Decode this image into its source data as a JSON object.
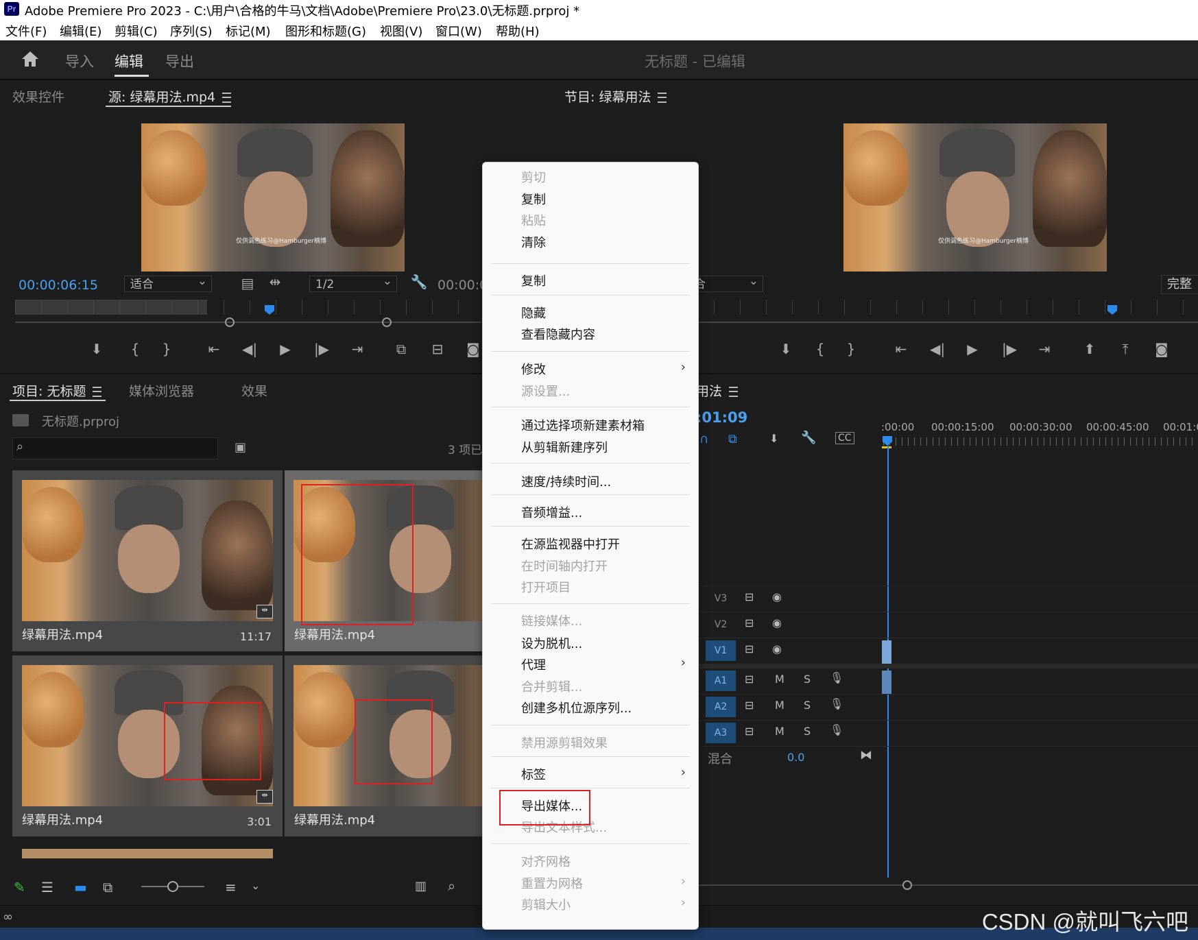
{
  "titlebar": {
    "app_icon": "Pr",
    "title": "Adobe Premiere Pro 2023 - C:\\用户\\合格的牛马\\文档\\Adobe\\Premiere Pro\\23.0\\无标题.prproj *"
  },
  "menubar": [
    "文件(F)",
    "编辑(E)",
    "剪辑(C)",
    "序列(S)",
    "标记(M)",
    "图形和标题(G)",
    "视图(V)",
    "窗口(W)",
    "帮助(H)"
  ],
  "workspace": {
    "tabs": [
      "导入",
      "编辑",
      "导出"
    ],
    "active_tab": "编辑",
    "project_status": "无标题 - 已编辑"
  },
  "source_panel": {
    "tabs": [
      "效果控件",
      "源: 绿幕用法.mp4"
    ],
    "timecode": "00:00:06:15",
    "fit": "适合",
    "resolution": "1/2",
    "timecode_right": "00:00:0",
    "video_caption": "仅供调色练习@Hamburger楠博"
  },
  "program_panel": {
    "tab": "节目: 绿幕用法",
    "fit": "合",
    "quality": "完整"
  },
  "project_panel": {
    "tabs": [
      "项目: 无标题",
      "媒体浏览器",
      "效果"
    ],
    "project_file": "无标题.prproj",
    "item_count": "3 项已",
    "items": [
      {
        "name": "绿幕用法.mp4",
        "duration": "11:17"
      },
      {
        "name": "绿幕用法.mp4",
        "duration": ""
      },
      {
        "name": "绿幕用法.mp4",
        "duration": "3:01"
      },
      {
        "name": "绿幕用法.mp4",
        "duration": ""
      }
    ]
  },
  "timeline": {
    "tab": "用法",
    "timecode": ":01:09",
    "ruler": [
      ":00:00",
      "00:00:15:00",
      "00:00:30:00",
      "00:00:45:00",
      "00:01:0"
    ],
    "video_tracks": [
      "V3",
      "V2",
      "V1"
    ],
    "audio_tracks": [
      "A1",
      "A2",
      "A3"
    ],
    "mute": "M",
    "solo": "S",
    "mix_label": "混合",
    "mix_value": "0.0"
  },
  "context_menu": [
    {
      "label": "剪切",
      "enabled": false
    },
    {
      "label": "复制",
      "enabled": true
    },
    {
      "label": "粘贴",
      "enabled": false
    },
    {
      "label": "清除",
      "enabled": true
    },
    {
      "label": "复制",
      "enabled": true
    },
    {
      "label": "隐藏",
      "enabled": true
    },
    {
      "label": "查看隐藏内容",
      "enabled": true
    },
    {
      "label": "修改",
      "enabled": true,
      "submenu": true
    },
    {
      "label": "源设置...",
      "enabled": false
    },
    {
      "label": "通过选择项新建素材箱",
      "enabled": true
    },
    {
      "label": "从剪辑新建序列",
      "enabled": true
    },
    {
      "label": "速度/持续时间...",
      "enabled": true
    },
    {
      "label": "音频增益...",
      "enabled": true
    },
    {
      "label": "在源监视器中打开",
      "enabled": true
    },
    {
      "label": "在时间轴内打开",
      "enabled": false
    },
    {
      "label": "打开项目",
      "enabled": false
    },
    {
      "label": "链接媒体...",
      "enabled": false
    },
    {
      "label": "设为脱机...",
      "enabled": true
    },
    {
      "label": "代理",
      "enabled": true,
      "submenu": true
    },
    {
      "label": "合并剪辑...",
      "enabled": false
    },
    {
      "label": "创建多机位源序列...",
      "enabled": true
    },
    {
      "label": "禁用源剪辑效果",
      "enabled": false
    },
    {
      "label": "标签",
      "enabled": true,
      "submenu": true
    },
    {
      "label": "导出媒体...",
      "enabled": true
    },
    {
      "label": "导出文本样式...",
      "enabled": false
    },
    {
      "label": "对齐网格",
      "enabled": false
    },
    {
      "label": "重置为网格",
      "enabled": false,
      "submenu": true
    },
    {
      "label": "剪辑大小",
      "enabled": false,
      "submenu": true
    }
  ],
  "watermark": "CSDN @就叫飞六吧",
  "colors": {
    "accent_blue": "#2d8ceb",
    "highlight_red": "#e02020",
    "timecode_blue": "#4aa0f0"
  }
}
